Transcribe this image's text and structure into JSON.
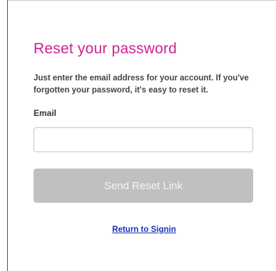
{
  "form": {
    "title": "Reset your password",
    "intro": "Just enter the email address for your account. If you've forgotten your password, it's easy to reset it.",
    "email_label": "Email",
    "email_value": "",
    "email_placeholder": "",
    "send_button_label": "Send Reset Link",
    "return_link_label": "Return to Signin"
  },
  "colors": {
    "title": "#d0218e",
    "button_disabled_bg": "#c0c0c0",
    "link": "#1a33b8",
    "frame_left_border": "#8a2a8e"
  }
}
